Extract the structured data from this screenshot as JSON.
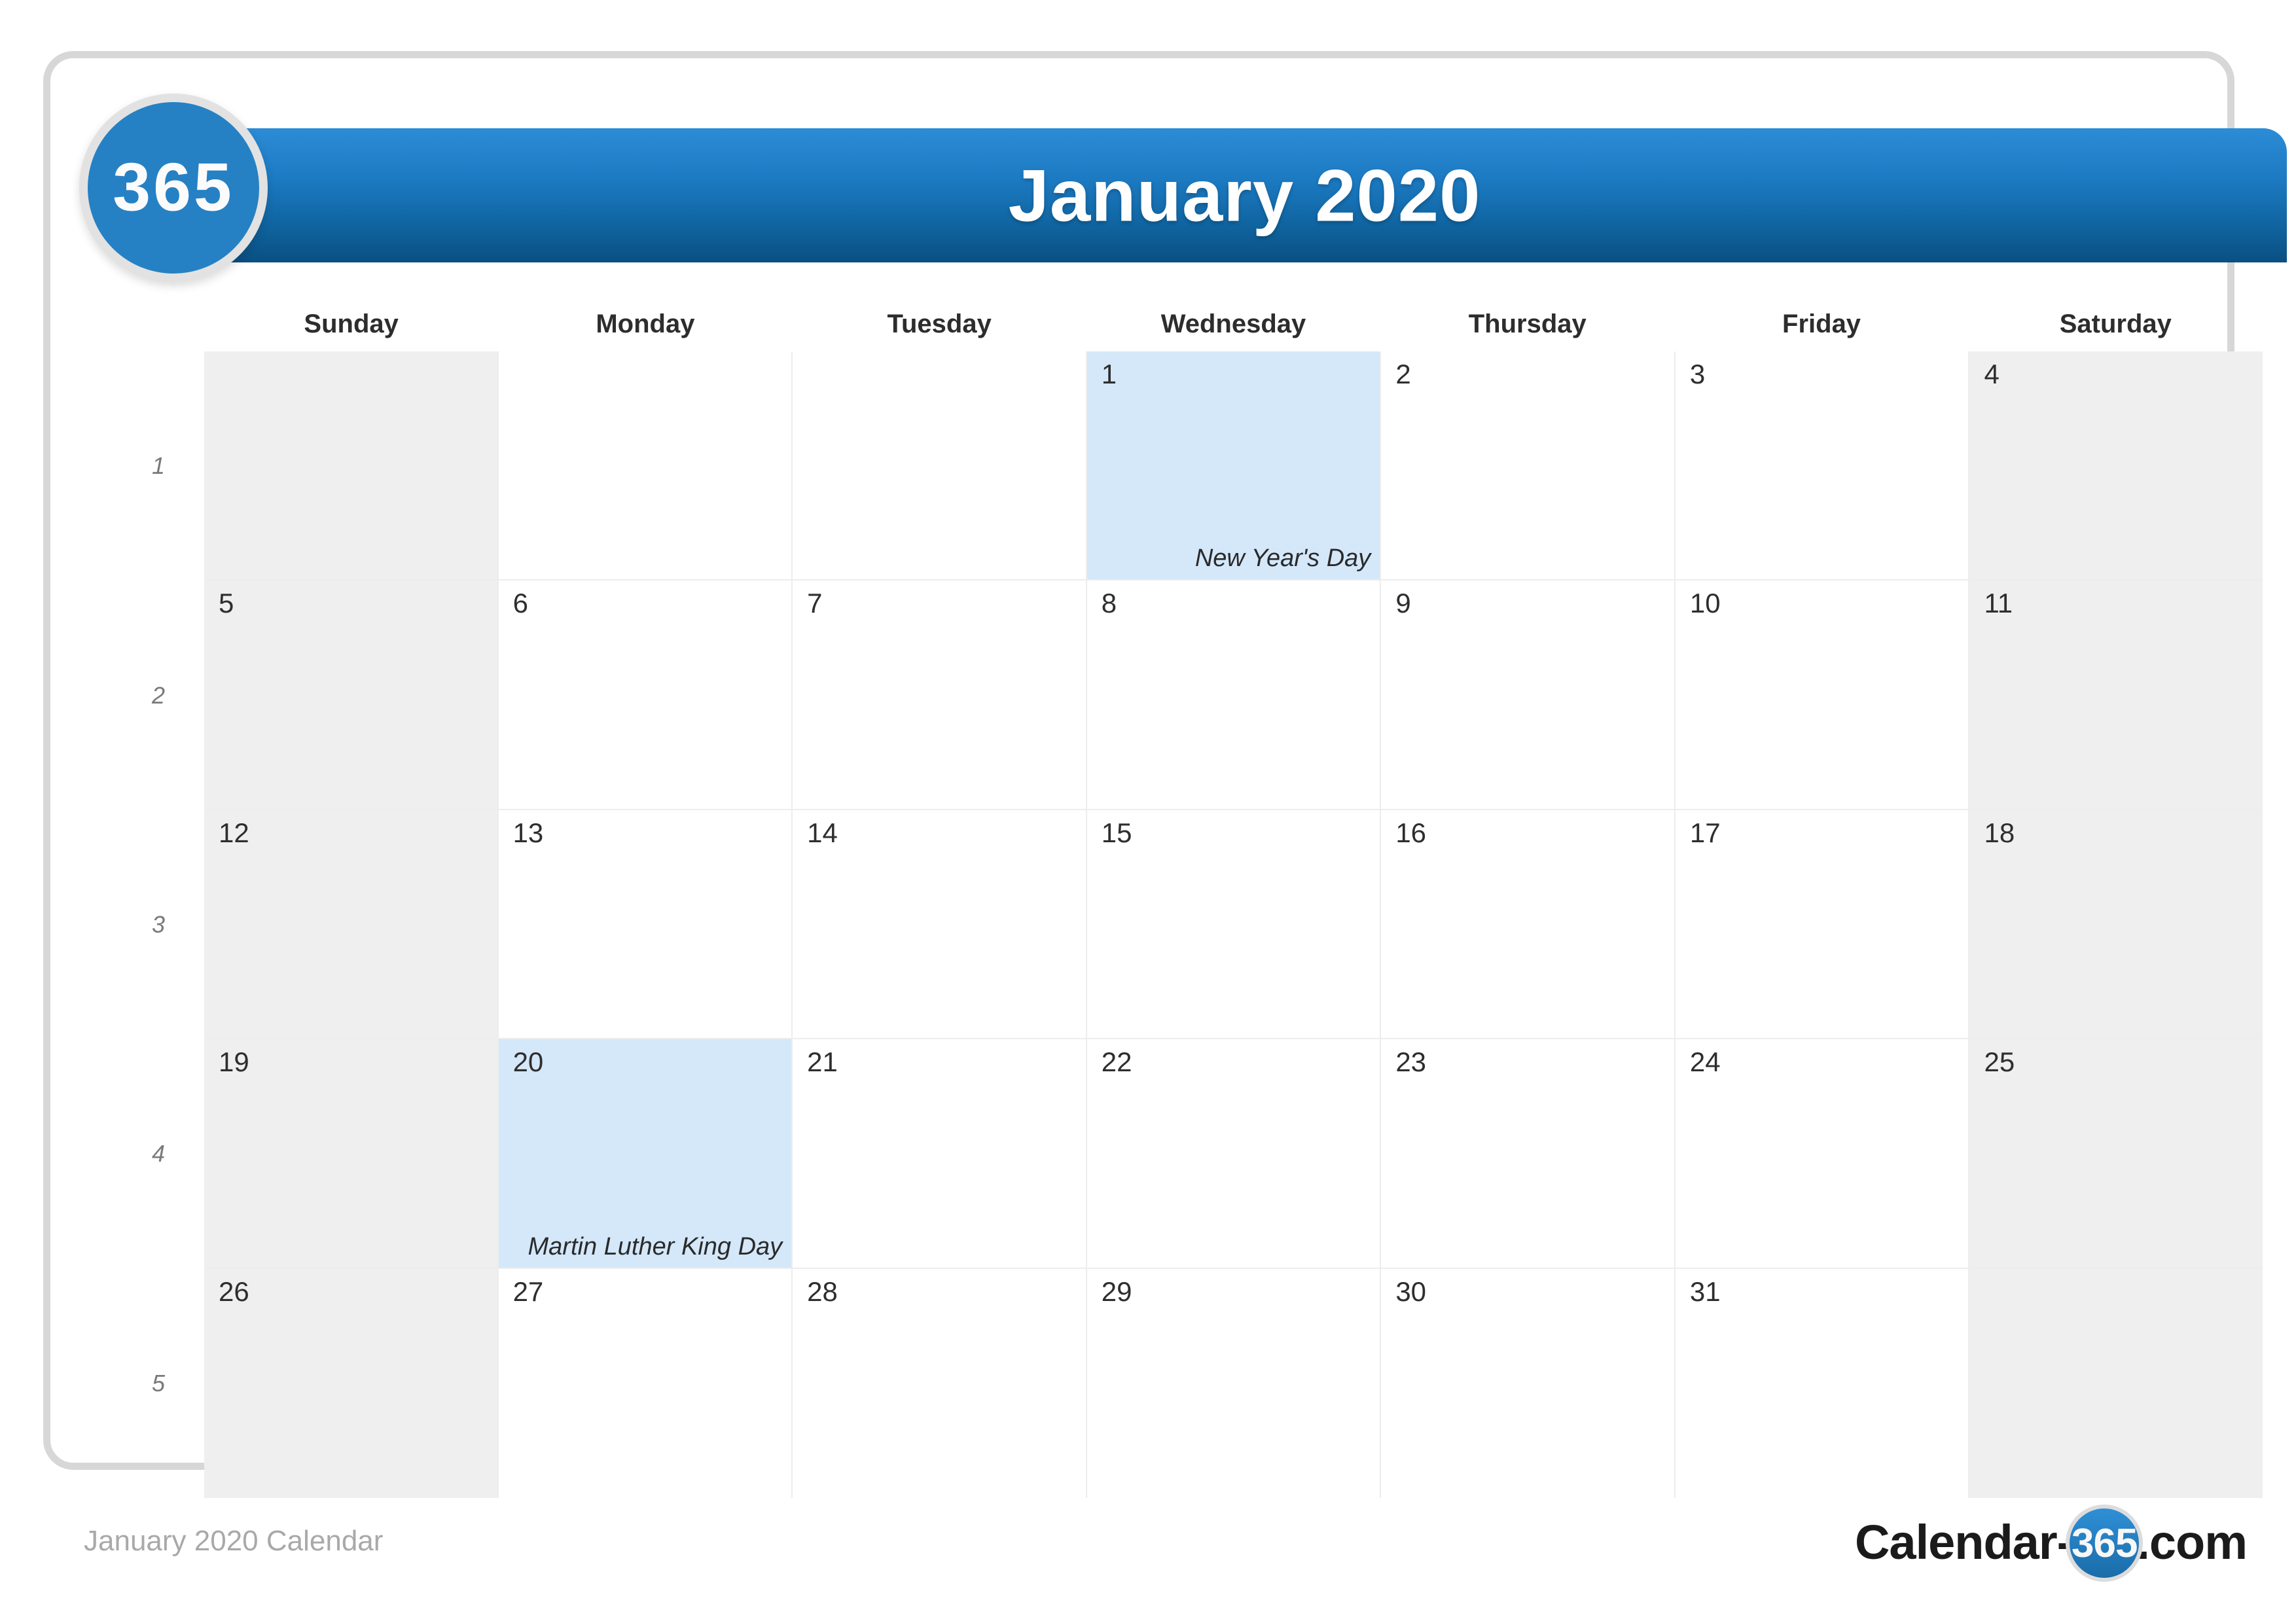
{
  "logo": {
    "badge_text": "365"
  },
  "header": {
    "title": "January 2020"
  },
  "weekdays": [
    "Sunday",
    "Monday",
    "Tuesday",
    "Wednesday",
    "Thursday",
    "Friday",
    "Saturday"
  ],
  "week_numbers": [
    "1",
    "2",
    "3",
    "4",
    "5"
  ],
  "weeks": [
    {
      "days": [
        {
          "date": "",
          "event": "",
          "state": "blank-shaded"
        },
        {
          "date": "",
          "event": "",
          "state": "blank-white"
        },
        {
          "date": "",
          "event": "",
          "state": "blank-white"
        },
        {
          "date": "1",
          "event": "New Year's Day",
          "state": "holiday"
        },
        {
          "date": "2",
          "event": "",
          "state": "weekday"
        },
        {
          "date": "3",
          "event": "",
          "state": "weekday"
        },
        {
          "date": "4",
          "event": "",
          "state": "weekend"
        }
      ]
    },
    {
      "days": [
        {
          "date": "5",
          "event": "",
          "state": "weekend"
        },
        {
          "date": "6",
          "event": "",
          "state": "weekday"
        },
        {
          "date": "7",
          "event": "",
          "state": "weekday"
        },
        {
          "date": "8",
          "event": "",
          "state": "weekday"
        },
        {
          "date": "9",
          "event": "",
          "state": "weekday"
        },
        {
          "date": "10",
          "event": "",
          "state": "weekday"
        },
        {
          "date": "11",
          "event": "",
          "state": "weekend"
        }
      ]
    },
    {
      "days": [
        {
          "date": "12",
          "event": "",
          "state": "weekend"
        },
        {
          "date": "13",
          "event": "",
          "state": "weekday"
        },
        {
          "date": "14",
          "event": "",
          "state": "weekday"
        },
        {
          "date": "15",
          "event": "",
          "state": "weekday"
        },
        {
          "date": "16",
          "event": "",
          "state": "weekday"
        },
        {
          "date": "17",
          "event": "",
          "state": "weekday"
        },
        {
          "date": "18",
          "event": "",
          "state": "weekend"
        }
      ]
    },
    {
      "days": [
        {
          "date": "19",
          "event": "",
          "state": "weekend"
        },
        {
          "date": "20",
          "event": "Martin Luther King Day",
          "state": "holiday"
        },
        {
          "date": "21",
          "event": "",
          "state": "weekday"
        },
        {
          "date": "22",
          "event": "",
          "state": "weekday"
        },
        {
          "date": "23",
          "event": "",
          "state": "weekday"
        },
        {
          "date": "24",
          "event": "",
          "state": "weekday"
        },
        {
          "date": "25",
          "event": "",
          "state": "weekend"
        }
      ]
    },
    {
      "days": [
        {
          "date": "26",
          "event": "",
          "state": "weekend"
        },
        {
          "date": "27",
          "event": "",
          "state": "weekday"
        },
        {
          "date": "28",
          "event": "",
          "state": "weekday"
        },
        {
          "date": "29",
          "event": "",
          "state": "weekday"
        },
        {
          "date": "30",
          "event": "",
          "state": "weekday"
        },
        {
          "date": "31",
          "event": "",
          "state": "weekday"
        },
        {
          "date": "",
          "event": "",
          "state": "blank-shaded"
        }
      ]
    }
  ],
  "watermark": {
    "text": "365"
  },
  "footer": {
    "caption": "January 2020 Calendar",
    "site_name_pre": "Calendar-",
    "site_badge": "365",
    "site_name_post": ".com"
  },
  "colors": {
    "brand_blue": "#2581c4",
    "header_gradient_top": "#2c8cd6",
    "header_gradient_bottom": "#0a4f81",
    "holiday_highlight": "#d4e8fa",
    "weekend_shade": "#efefef",
    "grid_line": "#ededed",
    "frame_border": "#d7d7d7",
    "footer_text": "#a9a9a9"
  }
}
